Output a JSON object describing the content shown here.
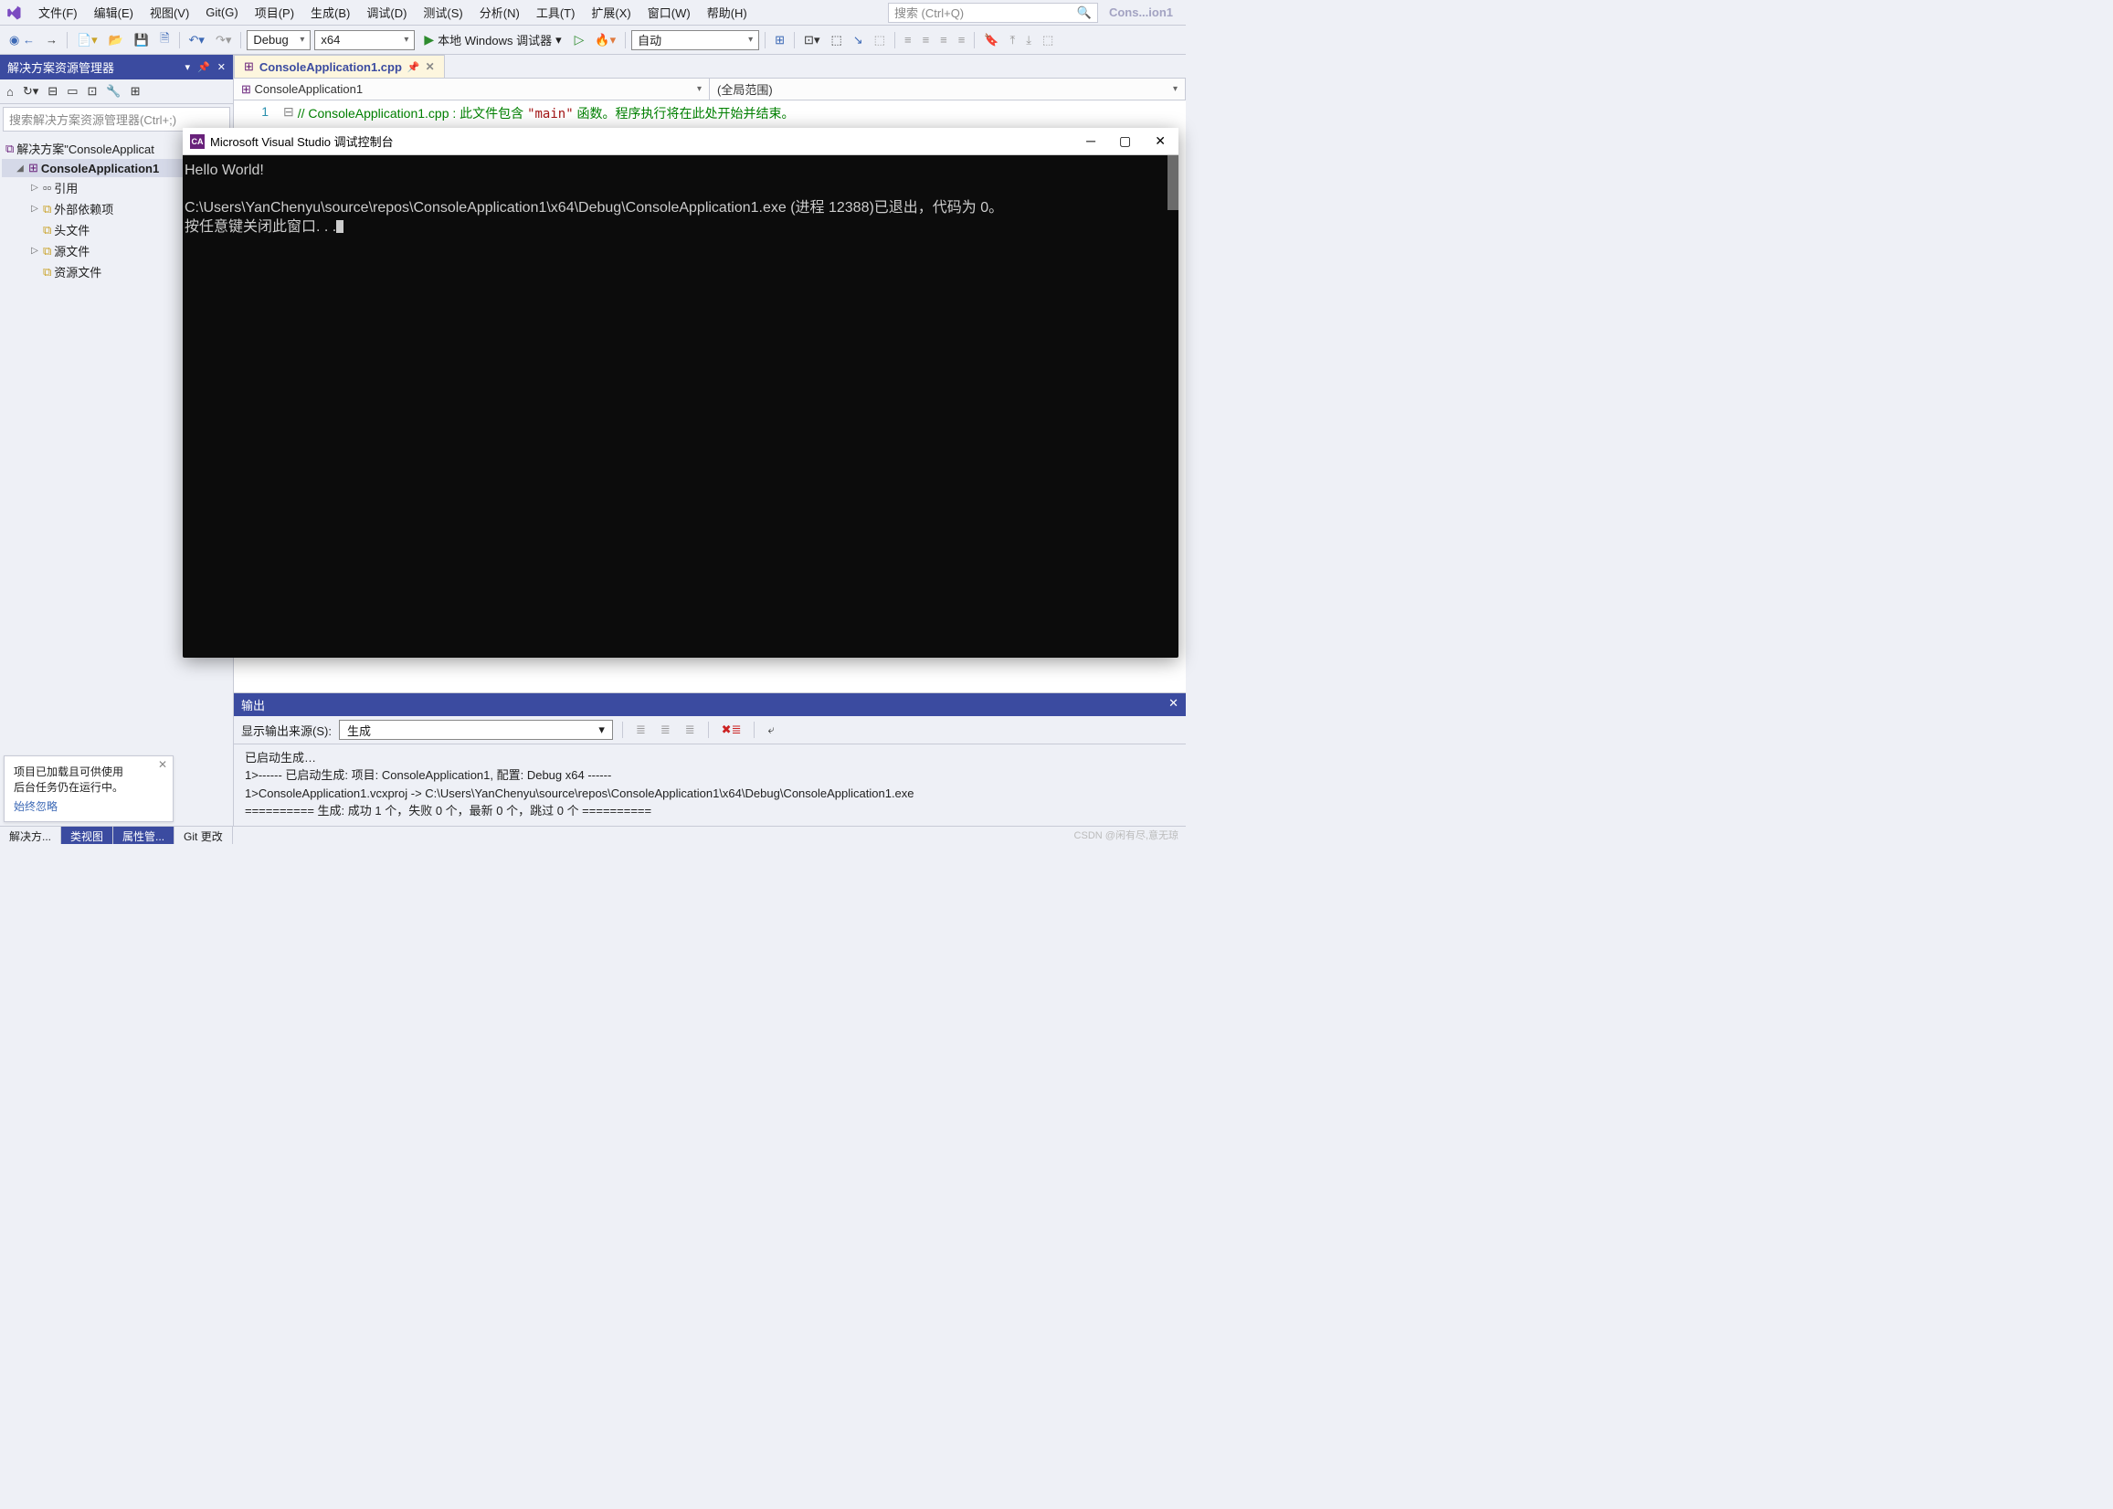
{
  "menu": {
    "items": [
      "文件(F)",
      "编辑(E)",
      "视图(V)",
      "Git(G)",
      "项目(P)",
      "生成(B)",
      "调试(D)",
      "测试(S)",
      "分析(N)",
      "工具(T)",
      "扩展(X)",
      "窗口(W)",
      "帮助(H)"
    ],
    "search_placeholder": "搜索 (Ctrl+Q)",
    "appname": "Cons...ion1"
  },
  "toolbar": {
    "config": "Debug",
    "platform": "x64",
    "debugger_label": "本地 Windows 调试器",
    "auto": "自动"
  },
  "solution_explorer": {
    "title": "解决方案资源管理器",
    "search_placeholder": "搜索解决方案资源管理器(Ctrl+;)",
    "root": "解决方案\"ConsoleApplicat",
    "project": "ConsoleApplication1",
    "nodes": [
      "引用",
      "外部依赖项",
      "头文件",
      "源文件",
      "资源文件"
    ]
  },
  "editor": {
    "tab": "ConsoleApplication1.cpp",
    "nav_left": "ConsoleApplication1",
    "nav_right": "(全局范围)",
    "line_no": "1",
    "comment_a": "// ConsoleApplication1.cpp : 此文件包含 ",
    "comment_str": "\"main\"",
    "comment_b": " 函数。程序执行将在此处开始并结束。"
  },
  "console": {
    "title": "Microsoft Visual Studio 调试控制台",
    "line1": "Hello World!",
    "line2": "C:\\Users\\YanChenyu\\source\\repos\\ConsoleApplication1\\x64\\Debug\\ConsoleApplication1.exe (进程 12388)已退出，代码为 0。",
    "line3": "按任意键关闭此窗口. . ."
  },
  "output": {
    "title": "输出",
    "source_label": "显示输出来源(S):",
    "source_value": "生成",
    "l1": "已启动生成…",
    "l2": "1>------ 已启动生成: 项目: ConsoleApplication1, 配置: Debug x64 ------",
    "l3": "1>ConsoleApplication1.vcxproj -> C:\\Users\\YanChenyu\\source\\repos\\ConsoleApplication1\\x64\\Debug\\ConsoleApplication1.exe",
    "l4": "========== 生成: 成功 1 个，失败 0 个，最新 0 个，跳过 0 个 =========="
  },
  "notif": {
    "l1": "项目已加载且可供使用",
    "l2": "后台任务仍在运行中。",
    "link": "始终忽略"
  },
  "status": {
    "t1": "解决方...",
    "t2": "类视图",
    "t3": "属性管...",
    "t4": "Git 更改"
  },
  "watermark": "CSDN @闲有尽,意无琼"
}
